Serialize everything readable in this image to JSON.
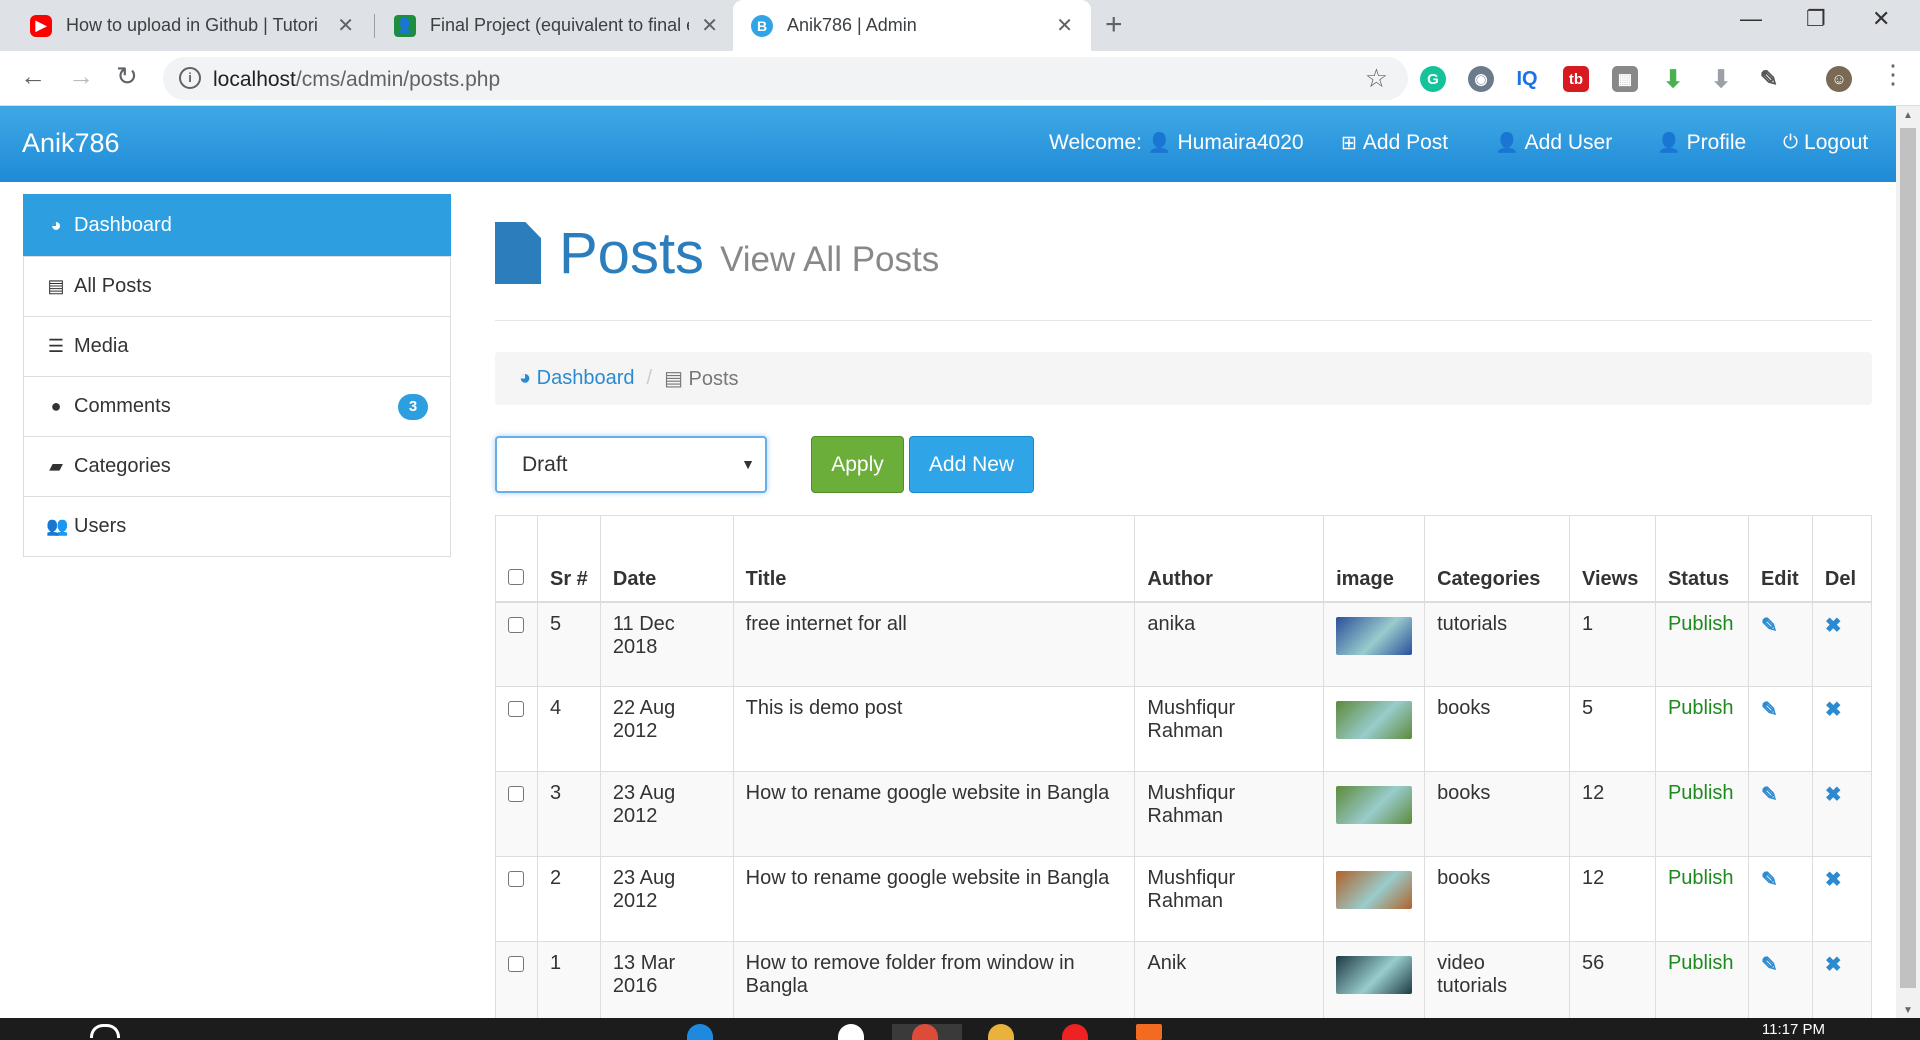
{
  "browser": {
    "tabs": [
      {
        "title": "How to upload in Github | Tutori",
        "favicon": "youtube-icon",
        "active": false
      },
      {
        "title": "Final Project (equivalent to final e",
        "favicon": "classroom-icon",
        "active": false
      },
      {
        "title": "Anik786 | Admin",
        "favicon": "bootstrap-icon",
        "active": true
      }
    ],
    "url_host": "localhost",
    "url_path": "/cms/admin/posts.php"
  },
  "site": {
    "brand": "Anik786",
    "nav": {
      "welcome": "Welcome:",
      "user": "Humaira4020",
      "add_post": "Add Post",
      "add_user": "Add User",
      "profile": "Profile",
      "logout": "Logout"
    }
  },
  "sidebar": {
    "items": [
      {
        "label": "Dashboard",
        "icon": "dashboard-icon"
      },
      {
        "label": "All Posts",
        "icon": "file-icon"
      },
      {
        "label": "Media",
        "icon": "database-icon"
      },
      {
        "label": "Comments",
        "icon": "comment-icon",
        "badge": "3"
      },
      {
        "label": "Categories",
        "icon": "folder-open-icon"
      },
      {
        "label": "Users",
        "icon": "users-icon"
      }
    ]
  },
  "page": {
    "title": "Posts",
    "subtitle": "View All Posts",
    "breadcrumb": {
      "home": "Dashboard",
      "current": "Posts"
    },
    "bulk_select": "Draft",
    "apply": "Apply",
    "add_new": "Add New"
  },
  "table": {
    "headers": [
      "Sr #",
      "Date",
      "Title",
      "Author",
      "image",
      "Categories",
      "Views",
      "Status",
      "Edit",
      "Del"
    ],
    "rows": [
      {
        "sr": "5",
        "date": "11 Dec 2018",
        "title": "free internet for all",
        "author": "anika",
        "category": "tutorials",
        "views": "1",
        "status": "Publish",
        "thumb_color": "#2a4f9a"
      },
      {
        "sr": "4",
        "date": "22 Aug 2012",
        "title": "This is demo post",
        "author": "Mushfiqur Rahman",
        "category": "books",
        "views": "5",
        "status": "Publish",
        "thumb_color": "#5d8a3a"
      },
      {
        "sr": "3",
        "date": "23 Aug 2012",
        "title": "How to rename google website in Bangla",
        "author": "Mushfiqur Rahman",
        "category": "books",
        "views": "12",
        "status": "Publish",
        "thumb_color": "#5d8a3a"
      },
      {
        "sr": "2",
        "date": "23 Aug 2012",
        "title": "How to rename google website in Bangla",
        "author": "Mushfiqur Rahman",
        "category": "books",
        "views": "12",
        "status": "Publish",
        "thumb_color": "#b0622a"
      },
      {
        "sr": "1",
        "date": "13 Mar 2016",
        "title": "How to remove folder from window in Bangla",
        "author": "Anik",
        "category": "video tutorials",
        "views": "56",
        "status": "Publish",
        "thumb_color": "#1d3a42"
      }
    ]
  },
  "taskbar": {
    "clock": "11:17 PM"
  }
}
